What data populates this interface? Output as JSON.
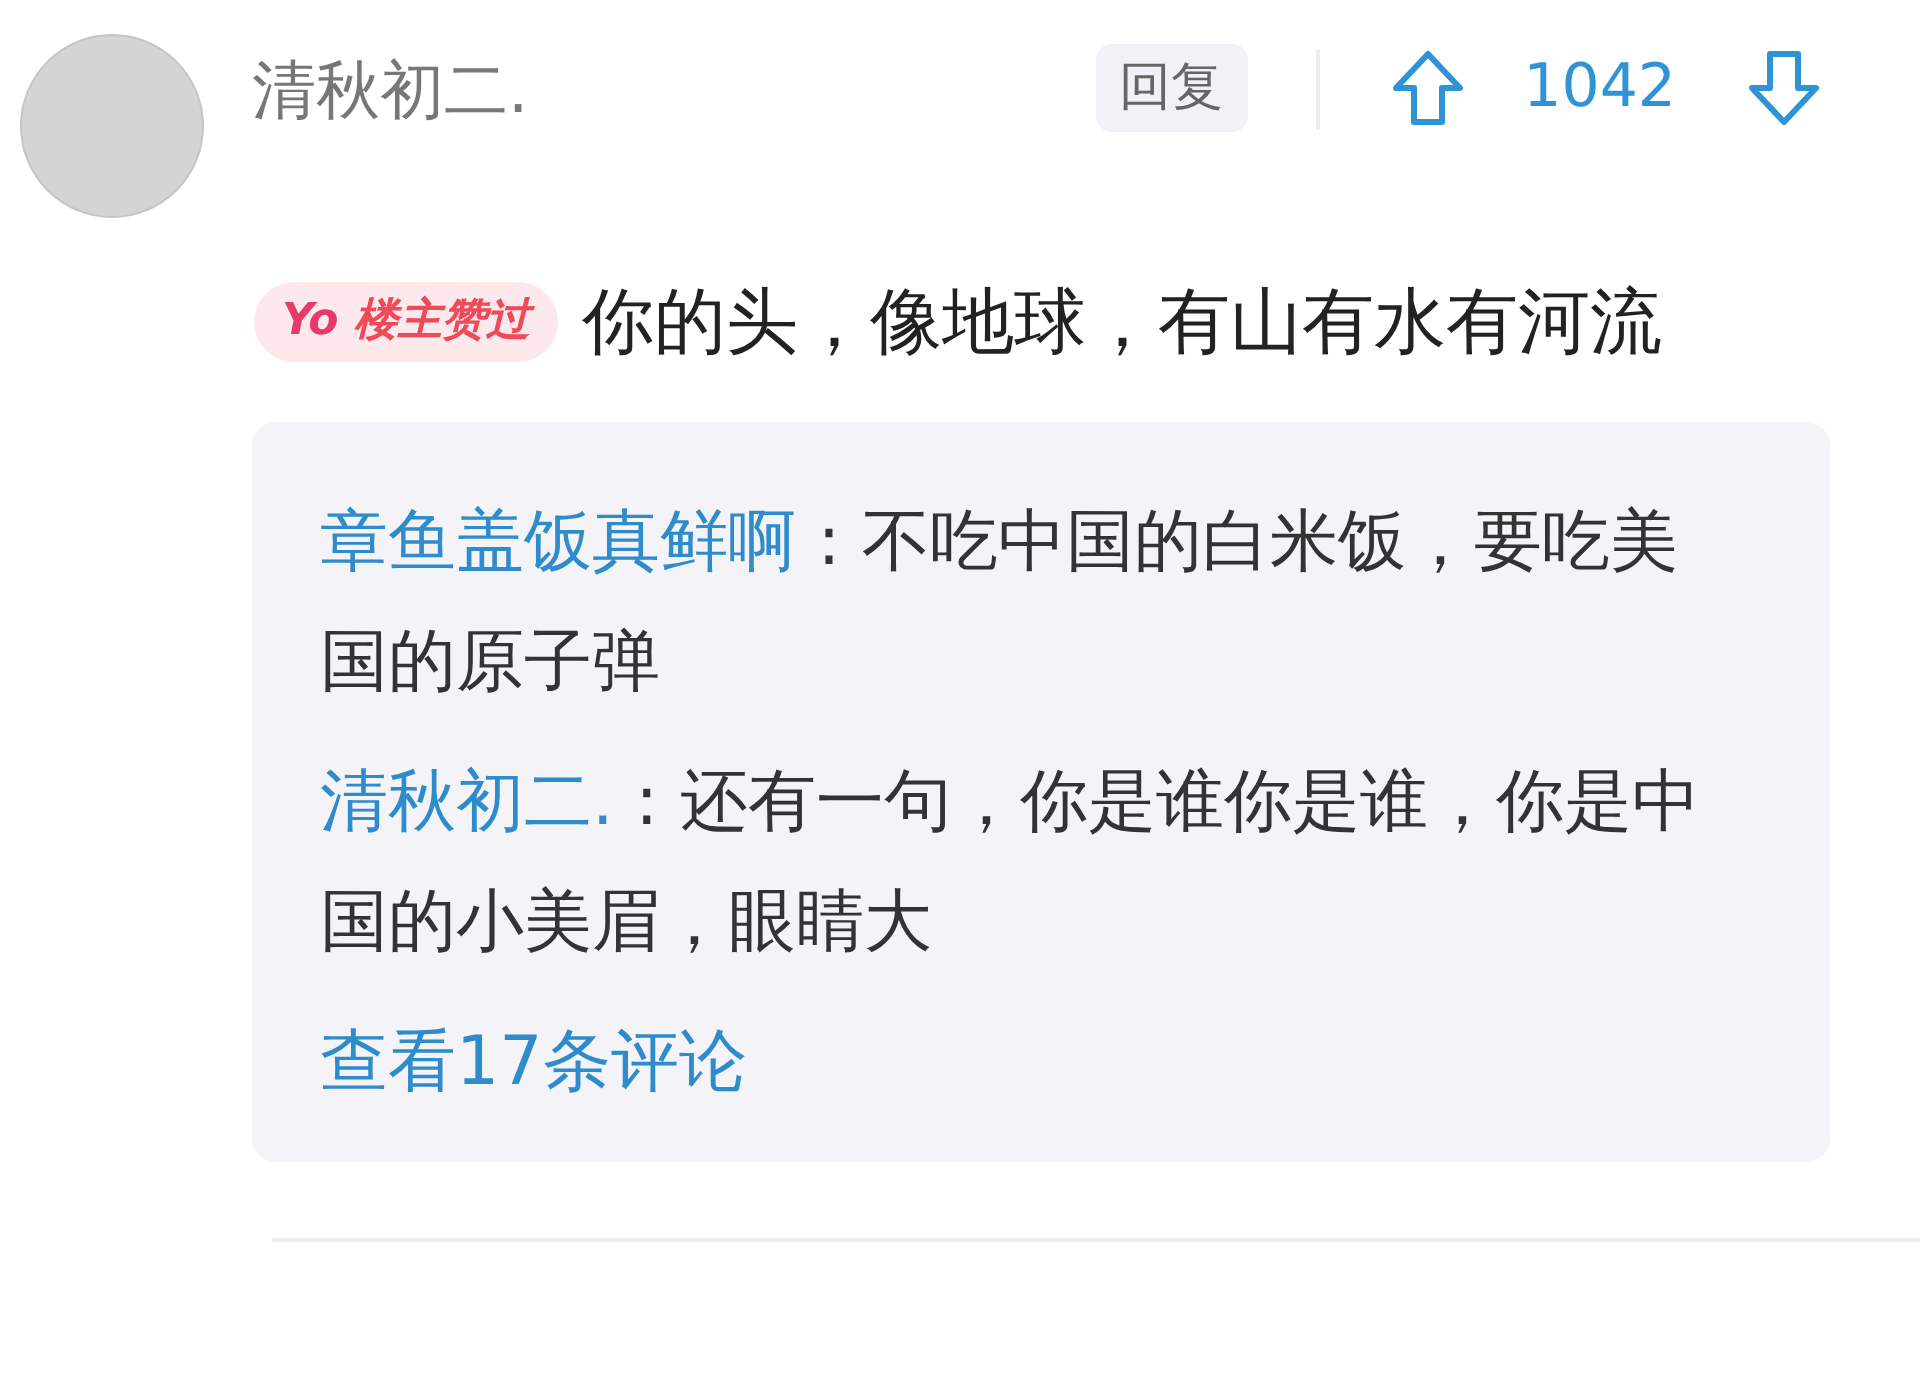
{
  "author": {
    "name": "清秋初二."
  },
  "reply_button": "回复",
  "votes": {
    "count": "1042"
  },
  "badge": {
    "logo": "Yo",
    "label": "楼主赞过"
  },
  "comment": "你的头，像地球，有山有水有河流",
  "replies": [
    {
      "author": "章鱼盖饭真鲜啊",
      "separator": ":",
      "text": "不吃中国的白米饭，要吃美国的原子弹"
    },
    {
      "author": "清秋初二.",
      "separator": ":",
      "text": "还有一句，你是谁你是谁，你是中国的小美眉，眼睛大"
    }
  ],
  "view_more": "查看17条评论"
}
